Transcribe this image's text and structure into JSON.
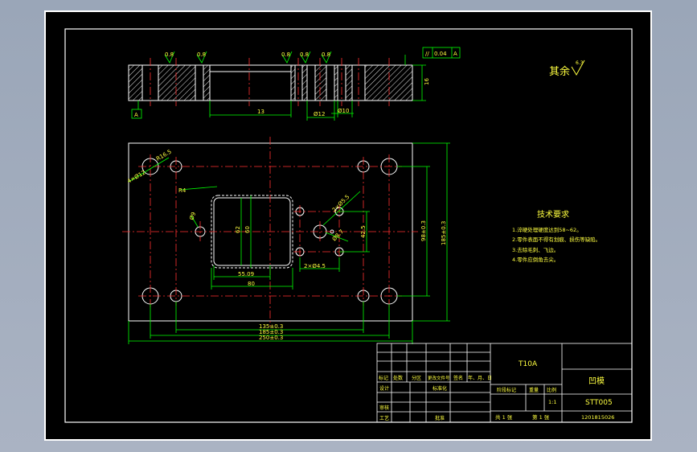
{
  "colors": {
    "background": "#000000",
    "frame": "#ffffff",
    "part": "#ffffff",
    "hatch": "#ffffff",
    "centerline": "#ff3030",
    "dimension": "#00ff00",
    "text_yellow": "#ffff40",
    "hidden": "#ffffff"
  },
  "section_view": {
    "roughness_labels": [
      "0.8",
      "0.8",
      "0.8",
      "0.8",
      "0.8"
    ],
    "height_dim": "16",
    "dim_13": "13",
    "dim_d12": "Ø12",
    "dim_d10": "Ø10",
    "datum": "A",
    "tolerance_symbol": "//",
    "tolerance_value": "0.04",
    "tolerance_datum": "A"
  },
  "surface_note": "其余",
  "surface_note_value": "6.3",
  "plan_view": {
    "dims": {
      "d4_top_left": "4×Ø12",
      "r_left": "R16.5",
      "r_fillet": "R4",
      "d_center_holes": "Ø9",
      "dim_62": "62",
      "dim_60": "60",
      "dim_55": "55.09",
      "dim_80": "80",
      "dim_h_right": "98±0.3",
      "dim_h_outer": "185±0.3",
      "dim_hole_rt": "2×Ø5.5",
      "dim_hole_r2": "Ø8.7",
      "dim_small": "2×Ø4.5",
      "dim_vert_small": "42.5",
      "dim_bottom_1": "135±0.3",
      "dim_bottom_2": "185±0.3",
      "dim_bottom_3": "250±0.3"
    }
  },
  "tech_requirements": {
    "title": "技术要求",
    "items": [
      "1.淬硬处理硬度达到58~62。",
      "2.零件表面不得有划痕、损伤等缺陷。",
      "3.去除毛刺、飞边。",
      "4.零件应倒角去尖。"
    ]
  },
  "title_block": {
    "material": "T10A",
    "part_name": "凹模",
    "drawing_no": "STT005",
    "school_no": "1201815026",
    "header_row": [
      "标记",
      "处数",
      "分区",
      "更改文件号",
      "签名",
      "年、月、日"
    ],
    "design": "设计",
    "standardize": "标准化",
    "review": "审核",
    "process": "工艺",
    "approve": "批准",
    "stage_mark": "阶段标记",
    "weight": "重量",
    "scale": "比例",
    "scale_value": "1:1",
    "sheets_total": "共  1  张",
    "sheet_no": "第  1  张"
  }
}
